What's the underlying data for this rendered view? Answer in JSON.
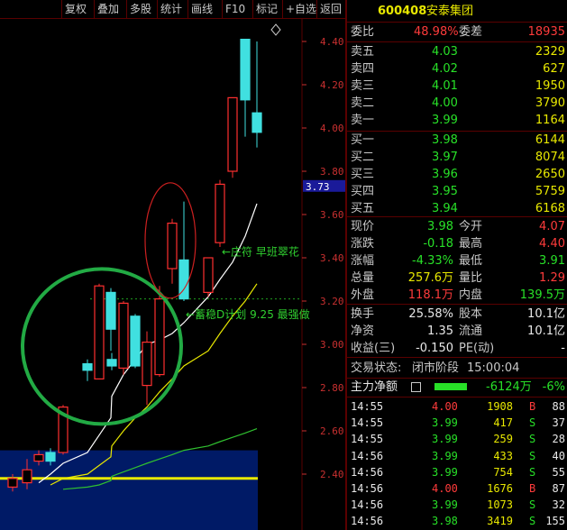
{
  "toolbar": {
    "items": [
      "复权",
      "叠加",
      "多股",
      "统计",
      "画线",
      "F10",
      "标记",
      "+自选",
      "返回"
    ]
  },
  "stock": {
    "code": "600408",
    "name": "安泰集团"
  },
  "wei": {
    "ratio_label": "委比",
    "ratio_value": "48.98%",
    "diff_label": "委差",
    "diff_value": "18935"
  },
  "asks": [
    {
      "label": "卖五",
      "price": "4.03",
      "vol": "2329"
    },
    {
      "label": "卖四",
      "price": "4.02",
      "vol": "627"
    },
    {
      "label": "卖三",
      "price": "4.01",
      "vol": "1950"
    },
    {
      "label": "卖二",
      "price": "4.00",
      "vol": "3790"
    },
    {
      "label": "卖一",
      "price": "3.99",
      "vol": "1164"
    }
  ],
  "bids": [
    {
      "label": "买一",
      "price": "3.98",
      "vol": "6144"
    },
    {
      "label": "买二",
      "price": "3.97",
      "vol": "8074"
    },
    {
      "label": "买三",
      "price": "3.96",
      "vol": "2650"
    },
    {
      "label": "买四",
      "price": "3.95",
      "vol": "5759"
    },
    {
      "label": "买五",
      "price": "3.94",
      "vol": "6168"
    }
  ],
  "quote": {
    "now_label": "现价",
    "now": "3.98",
    "open_label": "今开",
    "open": "4.07",
    "chg_label": "涨跌",
    "chg": "-0.18",
    "high_label": "最高",
    "high": "4.40",
    "pct_label": "涨幅",
    "pct": "-4.33%",
    "low_label": "最低",
    "low": "3.91",
    "vol_label": "总量",
    "vol": "257.6万",
    "vr_label": "量比",
    "vr": "1.29",
    "out_label": "外盘",
    "out": "118.1万",
    "in_label": "内盘",
    "in": "139.5万",
    "turn_label": "换手",
    "turn": "25.58%",
    "cap_label": "股本",
    "cap": "10.1亿",
    "nav_label": "净资",
    "nav": "1.35",
    "float_label": "流通",
    "float": "10.1亿",
    "eps_label": "收益(三)",
    "eps": "-0.150",
    "pe_label": "PE(动)",
    "pe": "-"
  },
  "status": {
    "label": "交易状态:",
    "value": "闭市阶段",
    "time": "15:00:04"
  },
  "mainflow": {
    "label": "主力净额",
    "value": "-6124万",
    "pct": "-6%"
  },
  "ticks": [
    {
      "time": "14:55",
      "price": "4.00",
      "vol": "1908",
      "side": "B",
      "n": "88"
    },
    {
      "time": "14:55",
      "price": "3.99",
      "vol": "417",
      "side": "S",
      "n": "37"
    },
    {
      "time": "14:55",
      "price": "3.99",
      "vol": "259",
      "side": "S",
      "n": "28"
    },
    {
      "time": "14:56",
      "price": "3.99",
      "vol": "433",
      "side": "S",
      "n": "40"
    },
    {
      "time": "14:56",
      "price": "3.99",
      "vol": "754",
      "side": "S",
      "n": "55"
    },
    {
      "time": "14:56",
      "price": "4.00",
      "vol": "1676",
      "side": "B",
      "n": "87"
    },
    {
      "time": "14:56",
      "price": "3.99",
      "vol": "1073",
      "side": "S",
      "n": "32"
    },
    {
      "time": "14:56",
      "price": "3.98",
      "vol": "3419",
      "side": "S",
      "n": "155"
    }
  ],
  "chart": {
    "price_ticks": [
      "4.40",
      "4.20",
      "4.00",
      "3.80",
      "3.60",
      "3.40",
      "3.20",
      "3.00",
      "2.80",
      "2.60",
      "2.40"
    ],
    "current_price_tag": "3.73",
    "annotation_1": "庄符 早班翠花",
    "annotation_2": "蓄稳D计划 9.25 最强做",
    "colors": {
      "up": "#ff3030",
      "down": "#40e0e0",
      "ma_white": "#ffffff",
      "ma_yellow": "#e8e800",
      "ma_green": "#30c030",
      "circle": "#22aa44",
      "ellipse": "#cc2020",
      "vol_area": "#001a66"
    }
  },
  "chart_data": {
    "type": "candlestick",
    "ylim": [
      2.3,
      4.62
    ],
    "ticks": [
      4.4,
      4.2,
      4.0,
      3.8,
      3.6,
      3.4,
      3.2,
      3.0,
      2.8,
      2.6,
      2.4
    ],
    "candles": [
      {
        "o": 2.34,
        "c": 2.38,
        "h": 2.4,
        "l": 2.32,
        "up": true
      },
      {
        "o": 2.36,
        "c": 2.42,
        "h": 2.47,
        "l": 2.33,
        "up": true
      },
      {
        "o": 2.46,
        "c": 2.49,
        "h": 2.51,
        "l": 2.44,
        "up": true
      },
      {
        "o": 2.5,
        "c": 2.46,
        "h": 2.52,
        "l": 2.44,
        "up": false
      },
      {
        "o": 2.5,
        "c": 2.71,
        "h": 2.72,
        "l": 2.49,
        "up": true
      },
      {
        "o": 2.91,
        "c": 2.88,
        "h": 2.93,
        "l": 2.83,
        "up": false
      },
      {
        "o": 2.84,
        "c": 3.27,
        "h": 3.28,
        "l": 2.84,
        "up": true
      },
      {
        "o": 3.24,
        "c": 3.07,
        "h": 3.26,
        "l": 2.97,
        "up": false
      },
      {
        "o": 2.93,
        "c": 2.9,
        "h": 2.96,
        "l": 2.88,
        "up": false
      },
      {
        "o": 2.89,
        "c": 3.19,
        "h": 3.2,
        "l": 2.86,
        "up": true
      },
      {
        "o": 3.13,
        "c": 2.9,
        "h": 3.14,
        "l": 2.89,
        "up": false
      },
      {
        "o": 2.81,
        "c": 3.01,
        "h": 3.06,
        "l": 2.72,
        "up": true
      },
      {
        "o": 2.86,
        "c": 3.21,
        "h": 3.27,
        "l": 2.85,
        "up": true
      },
      {
        "o": 3.35,
        "c": 3.56,
        "h": 3.58,
        "l": 3.28,
        "up": true
      },
      {
        "o": 3.39,
        "c": 3.21,
        "h": 3.66,
        "l": 3.2,
        "up": false
      },
      {
        "o": 3.24,
        "c": 3.4,
        "h": 3.4,
        "l": 3.22,
        "up": true
      },
      {
        "o": 3.47,
        "c": 3.74,
        "h": 3.76,
        "l": 3.45,
        "up": true
      },
      {
        "o": 3.8,
        "c": 4.14,
        "h": 4.14,
        "l": 3.77,
        "up": true
      },
      {
        "o": 4.41,
        "c": 4.13,
        "h": 4.41,
        "l": 3.96,
        "up": false
      },
      {
        "o": 4.07,
        "c": 3.98,
        "h": 4.4,
        "l": 3.91,
        "up": false
      }
    ],
    "ma5": [
      2.36,
      2.4,
      2.45,
      2.5,
      2.58,
      2.66,
      2.76,
      2.86,
      2.93,
      3.0,
      3.02,
      3.05,
      3.1,
      3.22,
      3.3,
      3.38,
      3.5,
      3.65
    ],
    "ma10": [
      2.35,
      2.38,
      2.4,
      2.44,
      2.48,
      2.53,
      2.6,
      2.66,
      2.71,
      2.78,
      2.84,
      2.9,
      2.97,
      3.05,
      3.13,
      3.2,
      3.28
    ],
    "ma30": [
      2.33,
      2.34,
      2.35,
      2.37,
      2.39,
      2.41,
      2.43,
      2.45,
      2.47,
      2.49,
      2.51,
      2.53,
      2.55,
      2.57,
      2.59,
      2.61
    ]
  }
}
